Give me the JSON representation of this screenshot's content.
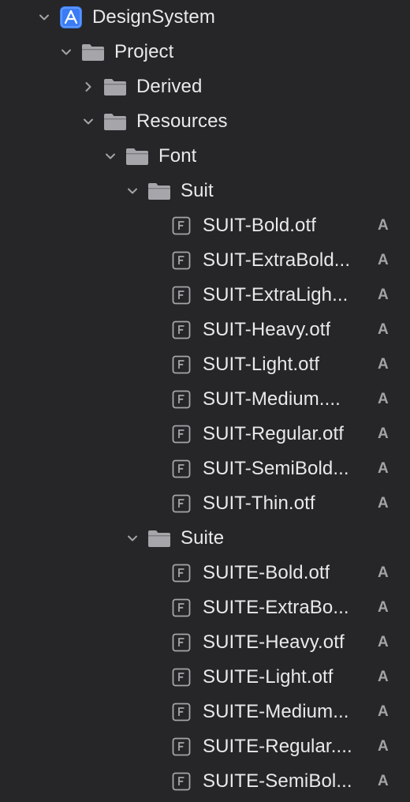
{
  "navigator": {
    "project": {
      "label": "DesignSystem"
    },
    "project_folder": {
      "label": "Project"
    },
    "derived_folder": {
      "label": "Derived"
    },
    "resources_folder": {
      "label": "Resources"
    },
    "font_folder": {
      "label": "Font"
    },
    "suit_folder": {
      "label": "Suit",
      "files": [
        {
          "label": "SUIT-Bold.otf",
          "status": "A"
        },
        {
          "label": "SUIT-ExtraBold...",
          "status": "A"
        },
        {
          "label": "SUIT-ExtraLigh...",
          "status": "A"
        },
        {
          "label": "SUIT-Heavy.otf",
          "status": "A"
        },
        {
          "label": "SUIT-Light.otf",
          "status": "A"
        },
        {
          "label": "SUIT-Medium....",
          "status": "A"
        },
        {
          "label": "SUIT-Regular.otf",
          "status": "A"
        },
        {
          "label": "SUIT-SemiBold...",
          "status": "A"
        },
        {
          "label": "SUIT-Thin.otf",
          "status": "A"
        }
      ]
    },
    "suite_folder": {
      "label": "Suite",
      "files": [
        {
          "label": "SUITE-Bold.otf",
          "status": "A"
        },
        {
          "label": "SUITE-ExtraBo...",
          "status": "A"
        },
        {
          "label": "SUITE-Heavy.otf",
          "status": "A"
        },
        {
          "label": "SUITE-Light.otf",
          "status": "A"
        },
        {
          "label": "SUITE-Medium...",
          "status": "A"
        },
        {
          "label": "SUITE-Regular....",
          "status": "A"
        },
        {
          "label": "SUITE-SemiBol...",
          "status": "A"
        }
      ]
    }
  },
  "colors": {
    "background": "#262628",
    "text": "#e9e9eb",
    "chevron": "#a3a3a8",
    "folder": "#a5a5aa",
    "app_icon": "#3b7cf5",
    "status_badge": "#a3a3a8"
  },
  "icons": {
    "project": "app-project-icon",
    "folder": "folder-icon",
    "file": "font-file-icon",
    "disclosure_open": "chevron-down-icon",
    "disclosure_closed": "chevron-right-icon"
  }
}
